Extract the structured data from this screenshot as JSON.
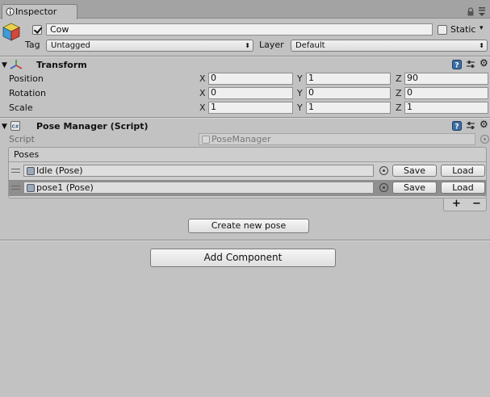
{
  "window": {
    "tab_title": "Inspector"
  },
  "gameobject": {
    "name": "Cow",
    "active": true,
    "static_label": "Static",
    "static_checked": false,
    "tag_label": "Tag",
    "tag_value": "Untagged",
    "layer_label": "Layer",
    "layer_value": "Default"
  },
  "transform": {
    "title": "Transform",
    "rows": [
      {
        "label": "Position",
        "x": "0",
        "y": "1",
        "z": "90"
      },
      {
        "label": "Rotation",
        "x": "0",
        "y": "0",
        "z": "0"
      },
      {
        "label": "Scale",
        "x": "1",
        "y": "1",
        "z": "1"
      }
    ],
    "axis_x": "X",
    "axis_y": "Y",
    "axis_z": "Z"
  },
  "pose_manager": {
    "title": "Pose Manager (Script)",
    "script_label": "Script",
    "script_value": "PoseManager",
    "list_header": "Poses",
    "poses": [
      {
        "name": "Idle (Pose)",
        "save": "Save",
        "load": "Load",
        "selected": false
      },
      {
        "name": "pose1 (Pose)",
        "save": "Save",
        "load": "Load",
        "selected": true
      }
    ],
    "add_symbol": "+",
    "remove_symbol": "−",
    "create_button": "Create new pose"
  },
  "add_component_button": "Add Component",
  "icons": {
    "tab": "inspector-icon",
    "lock": "lock-icon",
    "menu": "menu-icon",
    "gameobject": "cube-icon",
    "transform": "transform-axes-icon",
    "script": "script-icon",
    "help": "help-icon",
    "presets": "presets-icon",
    "settings": "gear-icon"
  },
  "colors": {
    "background": "#c2c2c2",
    "selected_row": "#8f8f8f",
    "help_icon": "#3a6ea5"
  }
}
